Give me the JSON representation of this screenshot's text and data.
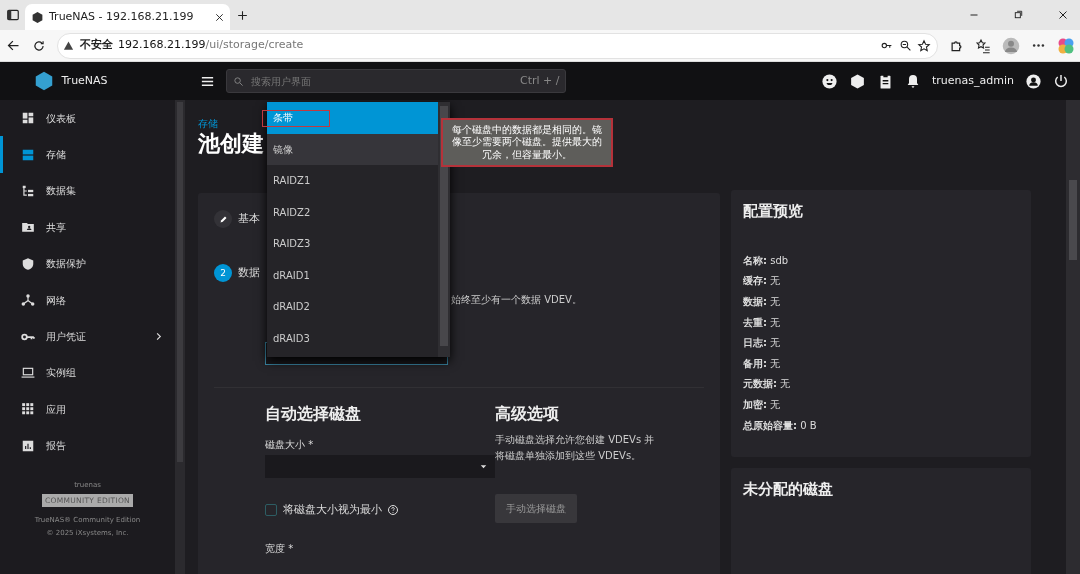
{
  "browser": {
    "tab_title": "TrueNAS - 192.168.21.199",
    "security_label": "不安全",
    "url_host": "192.168.21.199",
    "url_path": "/ui/storage/create"
  },
  "header": {
    "logo": "TrueNAS",
    "search": {
      "placeholder": "搜索用户界面"
    },
    "shortcut": "Ctrl + /",
    "user": "truenas_admin"
  },
  "sidebar": {
    "items": [
      {
        "label": "仪表板",
        "selected": false,
        "has_submenu": false
      },
      {
        "label": "存储",
        "selected": true,
        "has_submenu": false
      },
      {
        "label": "数据集",
        "selected": false,
        "has_submenu": false
      },
      {
        "label": "共享",
        "selected": false,
        "has_submenu": false
      },
      {
        "label": "数据保护",
        "selected": false,
        "has_submenu": false
      },
      {
        "label": "网络",
        "selected": false,
        "has_submenu": false
      },
      {
        "label": "用户凭证",
        "selected": false,
        "has_submenu": true
      },
      {
        "label": "实例组",
        "selected": false,
        "has_submenu": false
      },
      {
        "label": "应用",
        "selected": false,
        "has_submenu": false
      },
      {
        "label": "报告",
        "selected": false,
        "has_submenu": false
      }
    ],
    "footer": {
      "hostname": "truenas",
      "edition_badge": "COMMUNITY EDITION",
      "product": "TrueNAS® Community Edition",
      "copyright": "© 2025 iXsystems, Inc."
    }
  },
  "page": {
    "breadcrumb": "存储",
    "title": "池创建"
  },
  "wizard": {
    "steps": [
      {
        "kind": "done",
        "label": "基本"
      },
      {
        "kind": "active",
        "number": "2",
        "label": "数据"
      }
    ],
    "hint": "始终至少有一个数据 VDEV。",
    "layout_dropdown": {
      "options": [
        {
          "label": "条带",
          "selected": true,
          "hovered": false
        },
        {
          "label": "镜像",
          "selected": false,
          "hovered": true
        },
        {
          "label": "RAIDZ1",
          "selected": false,
          "hovered": false
        },
        {
          "label": "RAIDZ2",
          "selected": false,
          "hovered": false
        },
        {
          "label": "RAIDZ3",
          "selected": false,
          "hovered": false
        },
        {
          "label": "dRAID1",
          "selected": false,
          "hovered": false
        },
        {
          "label": "dRAID2",
          "selected": false,
          "hovered": false
        },
        {
          "label": "dRAID3",
          "selected": false,
          "hovered": false
        }
      ]
    },
    "tooltip": "每个磁盘中的数据都是相同的。镜像至少需要两个磁盘。提供最大的冗余，但容量最小。",
    "auto_select": {
      "title": "自动选择磁盘",
      "disk_size_label": "磁盘大小 *",
      "treat_min_label": "将磁盘大小视为最小",
      "treat_min_checked": false,
      "width_label": "宽度 *"
    },
    "advanced": {
      "title": "高级选项",
      "description": "手动磁盘选择允许您创建 VDEVs 并将磁盘单独添加到这些 VDEVs。",
      "button": "手动选择磁盘",
      "button_disabled": true
    }
  },
  "preview": {
    "title": "配置预览",
    "rows": [
      {
        "label": "名称:",
        "value": "sdb"
      },
      {
        "label": "缓存:",
        "value": "无"
      },
      {
        "label": "数据:",
        "value": "无"
      },
      {
        "label": "去重:",
        "value": "无"
      },
      {
        "label": "日志:",
        "value": "无"
      },
      {
        "label": "备用:",
        "value": "无"
      },
      {
        "label": "元数据:",
        "value": "无"
      },
      {
        "label": "加密:",
        "value": "无"
      },
      {
        "label": "总原始容量:",
        "value": "0 B"
      }
    ]
  },
  "unassigned": {
    "title": "未分配的磁盘"
  }
}
